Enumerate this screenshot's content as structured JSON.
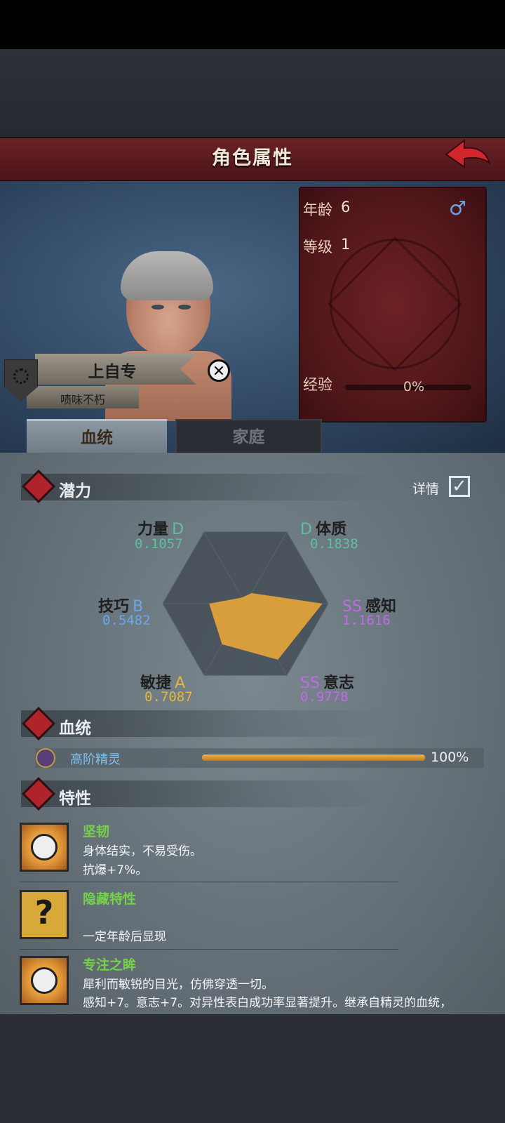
{
  "header": {
    "title": "角色属性",
    "back_icon": "back-arrow-icon"
  },
  "info_card": {
    "age_label": "年龄",
    "age_value": "6",
    "level_label": "等级",
    "level_value": "1",
    "exp_label": "经验",
    "exp_value": "0%",
    "gender_icon": "male-icon"
  },
  "character": {
    "name": "上自专",
    "title": "啧味不朽"
  },
  "tabs": [
    {
      "label": "血统"
    },
    {
      "label": "家庭"
    }
  ],
  "potential": {
    "section_title": "潜力",
    "details_label": "详情",
    "stats": [
      {
        "name": "力量",
        "grade": "D",
        "value": "0.1057"
      },
      {
        "name": "体质",
        "grade": "D",
        "value": "0.1838"
      },
      {
        "name": "技巧",
        "grade": "B",
        "value": "0.5482"
      },
      {
        "name": "感知",
        "grade": "SS",
        "value": "1.1616"
      },
      {
        "name": "敏捷",
        "grade": "A",
        "value": "0.7087"
      },
      {
        "name": "意志",
        "grade": "SS",
        "value": "0.9778"
      }
    ]
  },
  "chart_data": {
    "type": "radar",
    "axes": [
      "力量",
      "体质",
      "感知",
      "意志",
      "敏捷",
      "技巧"
    ],
    "values": [
      0.1057,
      0.1838,
      1.1616,
      0.9778,
      0.7087,
      0.5482
    ],
    "fill_color": "#e0a23a",
    "max": 1.25
  },
  "bloodline": {
    "section_title": "血统",
    "name": "高阶精灵",
    "percent": "100%"
  },
  "traits": {
    "section_title": "特性",
    "items": [
      {
        "title": "坚韧",
        "line1": "身体结实，不易受伤。",
        "line2": "抗爆+7%。",
        "icon": "smiley-sun-icon"
      },
      {
        "title": "隐藏特性",
        "line1": "",
        "line2": "一定年龄后显现",
        "icon": "question-mark-icon"
      },
      {
        "title": "专注之眸",
        "line1": "犀利而敏锐的目光，仿佛穿透一切。",
        "line2": "感知+7。意志+7。对异性表白成功率显著提升。继承自精灵的血统，",
        "icon": "smiley-sun-icon"
      }
    ]
  },
  "colors": {
    "grade_D": "#5fbf9a",
    "grade_B": "#6aa7e6",
    "grade_A": "#e6b53a",
    "grade_SS": "#c06ae8",
    "header_red": "#6b2226"
  }
}
